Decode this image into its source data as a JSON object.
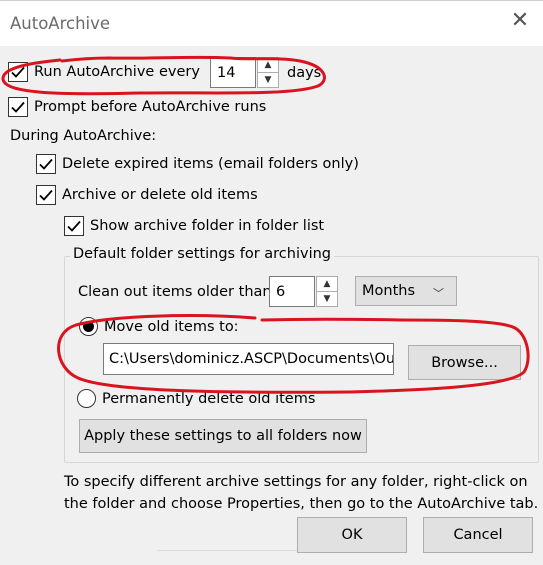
{
  "window": {
    "title": "AutoArchive"
  },
  "run_every": {
    "label": "Run AutoArchive every",
    "value": "14",
    "unit": "days",
    "checked": true
  },
  "prompt_before": {
    "label": "Prompt before AutoArchive runs",
    "checked": true
  },
  "during_label": "During AutoArchive:",
  "delete_expired": {
    "label": "Delete expired items (email folders only)",
    "checked": true
  },
  "archive_old": {
    "label": "Archive or delete old items",
    "checked": true
  },
  "show_archive_folder": {
    "label": "Show archive folder in folder list",
    "checked": true
  },
  "group": {
    "legend": "Default folder settings for archiving",
    "clean_out_label": "Clean out items older than",
    "clean_out_value": "6",
    "period": "Months",
    "move_option": {
      "label": "Move old items to:",
      "selected": true
    },
    "path_value": "C:\\Users\\dominicz.ASCP\\Documents\\Out",
    "browse_label": "Browse...",
    "delete_option": {
      "label": "Permanently delete old items",
      "selected": false
    },
    "apply_label": "Apply these settings to all folders now"
  },
  "note": {
    "line1": "To specify different archive settings for any folder, right-click on",
    "line2": "the folder and choose Properties, then go to the AutoArchive tab."
  },
  "buttons": {
    "ok": "OK",
    "cancel": "Cancel"
  },
  "colors": {
    "annotation": "#d9141e",
    "dialog_bg": "#f0f0f0",
    "button_bg": "#e1e1e1"
  },
  "icons": {
    "check": "checkmark-icon",
    "close": "close-icon",
    "spin_up": "arrow-up-icon",
    "spin_down": "arrow-down-icon",
    "dropdown": "chevron-down-icon"
  }
}
